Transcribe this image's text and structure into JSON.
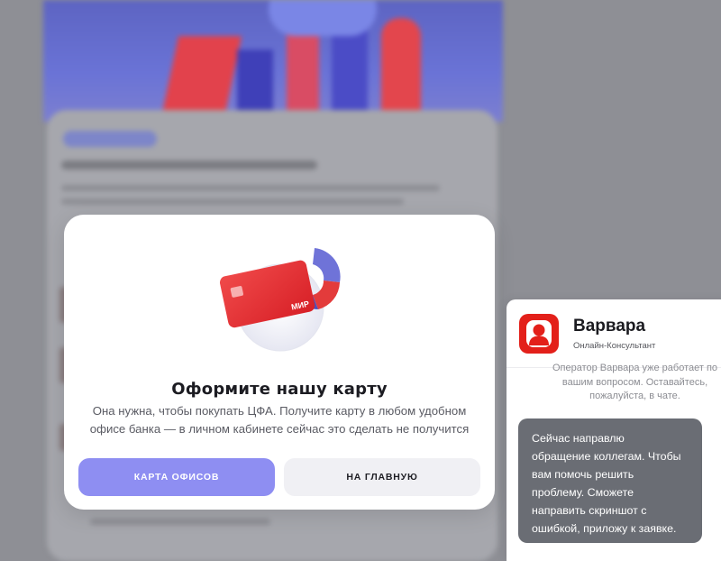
{
  "modal": {
    "title": "Оформите нашу карту",
    "text": "Она нужна, чтобы покупать ЦФА. Получите карту в любом удобном офисе банка — в личном кабинете сейчас это сделать не получится",
    "card_brand": "МИР",
    "buttons": {
      "offices_label": "КАРТА ОФИСОВ",
      "home_label": "НА ГЛАВНУЮ"
    }
  },
  "chat": {
    "name": "Варвара",
    "role": "Онлайн-Консультант",
    "system_lines": [
      "Оператор Варвара уже работает по",
      "вашим вопросом. Оставайтесь,",
      "пожалуйста, в чате."
    ],
    "message_lines": [
      "Сейчас направлю",
      "обращение коллегам. Чтобы",
      "вам помочь решить",
      "проблему. Сможете",
      "направить скриншот с",
      "ошибкой, приложу к заявке."
    ]
  },
  "colors": {
    "primary_button": "#8e8ef2",
    "secondary_button": "#f0f0f4",
    "brand_red": "#e3201a",
    "card_red": "#e52d2d",
    "bubble": "#6a6d74",
    "overlay": "#8e8f95"
  },
  "icons": {
    "avatar": "person-silhouette-icon",
    "illustration": "bank-card-illustration"
  }
}
